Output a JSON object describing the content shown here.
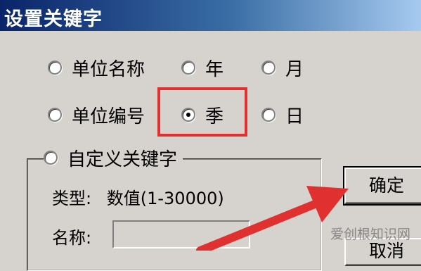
{
  "window": {
    "title": "设置关键字"
  },
  "options": {
    "unit_name": "单位名称",
    "year": "年",
    "month": "月",
    "unit_code": "单位编号",
    "quarter": "季",
    "day": "日",
    "custom": "自定义关键字",
    "selected": "季"
  },
  "custom_group": {
    "type_label": "类型:",
    "type_value": "数值(1-30000)",
    "name_label": "名称:",
    "name_value": ""
  },
  "buttons": {
    "ok": "确定",
    "cancel": "取消"
  },
  "annotation": {
    "highlight_color": "#e0302f",
    "arrow_color": "#e0302f"
  },
  "watermark": {
    "text": "爱创根知识网"
  }
}
